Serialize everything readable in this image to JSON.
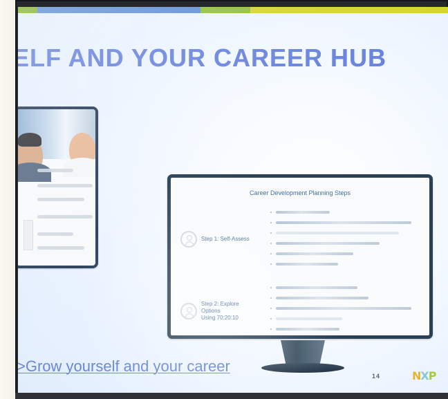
{
  "headline": "ELF AND YOUR CAREER HUB",
  "monitor": {
    "title": "Career Development Planning Steps",
    "steps": [
      {
        "label": "Step 1: Self-Assess"
      },
      {
        "label": "Step 2: Explore Options\nUsing 70:20:10"
      }
    ]
  },
  "bottom_link": "Grow yourself and your career",
  "footer": {
    "page_number": "14"
  },
  "logo": {
    "text_parts": [
      "N",
      "X",
      "P"
    ]
  },
  "colors": {
    "headline": "#6883dc",
    "monitor_frame": "#2b4055",
    "link": "#6686d2"
  }
}
